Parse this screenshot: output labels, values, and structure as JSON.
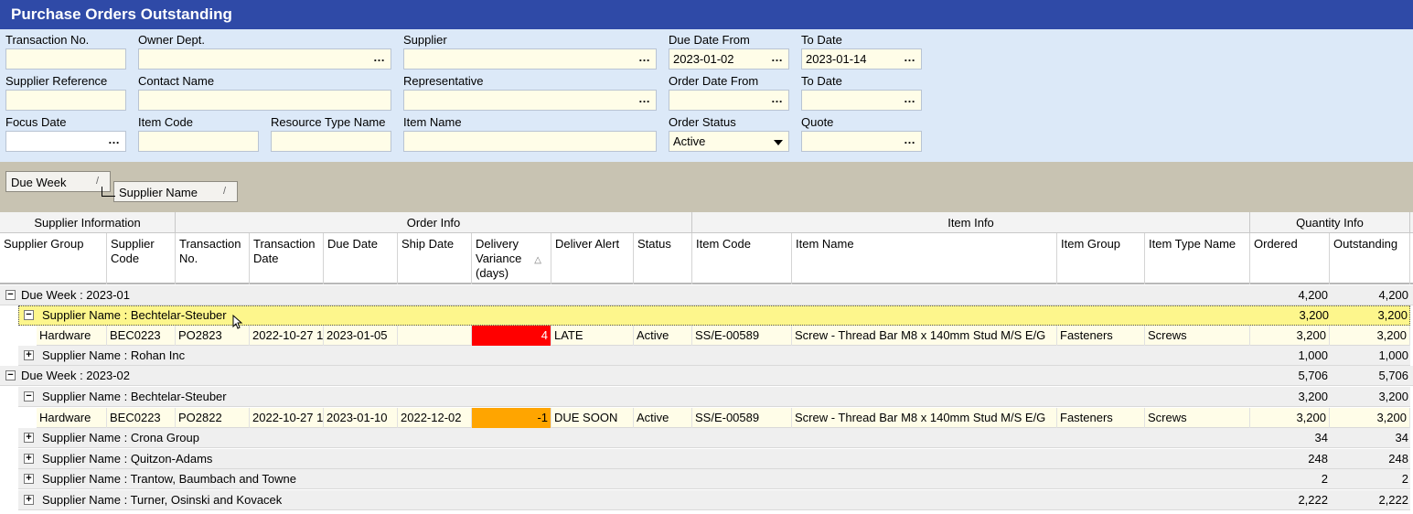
{
  "window": {
    "title": "Purchase Orders Outstanding"
  },
  "filters": {
    "transaction_no": {
      "label": "Transaction No.",
      "value": ""
    },
    "owner_dept": {
      "label": "Owner Dept.",
      "value": ""
    },
    "supplier": {
      "label": "Supplier",
      "value": ""
    },
    "due_date_from": {
      "label": "Due Date From",
      "value": "2023-01-02"
    },
    "due_to_date": {
      "label": "To Date",
      "value": "2023-01-14"
    },
    "supplier_reference": {
      "label": "Supplier Reference",
      "value": ""
    },
    "contact_name": {
      "label": "Contact Name",
      "value": ""
    },
    "representative": {
      "label": "Representative",
      "value": ""
    },
    "order_date_from": {
      "label": "Order Date From",
      "value": ""
    },
    "order_to_date": {
      "label": "To Date",
      "value": ""
    },
    "focus_date": {
      "label": "Focus Date",
      "value": ""
    },
    "item_code": {
      "label": "Item Code",
      "value": ""
    },
    "resource_type_name": {
      "label": "Resource Type Name",
      "value": ""
    },
    "item_name": {
      "label": "Item Name",
      "value": ""
    },
    "order_status": {
      "label": "Order Status",
      "value": "Active"
    },
    "quote": {
      "label": "Quote",
      "value": ""
    },
    "ellipsis": "…"
  },
  "grouping": {
    "level1": "Due Week",
    "level2": "Supplier Name",
    "sort_glyph": "/"
  },
  "bands": {
    "supplier_info": "Supplier Information",
    "order_info": "Order Info",
    "item_info": "Item Info",
    "quantity_info": "Quantity Info"
  },
  "columns": {
    "supplier_group": "Supplier Group",
    "supplier_code": "Supplier Code",
    "transaction_no": "Transaction No.",
    "transaction_date": "Transaction Date",
    "due_date": "Due Date",
    "ship_date": "Ship Date",
    "delivery_variance": "Delivery Variance (days)",
    "deliver_alert": "Deliver Alert",
    "status": "Status",
    "item_code": "Item Code",
    "item_name": "Item Name",
    "item_group": "Item Group",
    "item_type_name": "Item Type Name",
    "ordered": "Ordered",
    "outstanding": "Outstanding",
    "sort_arrow": "△"
  },
  "rows": {
    "week1": {
      "label": "Due Week : 2023-01",
      "ordered": "4,200",
      "outstanding": "4,200",
      "toggle": "−"
    },
    "week1_bech": {
      "label": "Supplier Name : Bechtelar-Steuber",
      "ordered": "3,200",
      "outstanding": "3,200",
      "toggle": "−"
    },
    "week1_bech_item": {
      "supplier_group": "Hardware",
      "supplier_code": "BEC0223",
      "transaction_no": "PO2823",
      "transaction_date": "2022-10-27 1",
      "due_date": "2023-01-05",
      "ship_date": "",
      "delivery_variance": "4",
      "deliver_alert": "LATE",
      "status": "Active",
      "item_code": "SS/E-00589",
      "item_name": "Screw - Thread Bar M8 x 140mm Stud M/S E/G",
      "item_group": "Fasteners",
      "item_type_name": "Screws",
      "ordered": "3,200",
      "outstanding": "3,200",
      "alert_color": "#ff0000"
    },
    "week1_rohan": {
      "label": "Supplier Name : Rohan Inc",
      "ordered": "1,000",
      "outstanding": "1,000",
      "toggle": "+"
    },
    "week2": {
      "label": "Due Week : 2023-02",
      "ordered": "5,706",
      "outstanding": "5,706",
      "toggle": "−"
    },
    "week2_bech": {
      "label": "Supplier Name : Bechtelar-Steuber",
      "ordered": "3,200",
      "outstanding": "3,200",
      "toggle": "−"
    },
    "week2_bech_item": {
      "supplier_group": "Hardware",
      "supplier_code": "BEC0223",
      "transaction_no": "PO2822",
      "transaction_date": "2022-10-27 1",
      "due_date": "2023-01-10",
      "ship_date": "2022-12-02",
      "delivery_variance": "-1",
      "deliver_alert": "DUE SOON",
      "status": "Active",
      "item_code": "SS/E-00589",
      "item_name": "Screw - Thread Bar M8 x 140mm Stud M/S E/G",
      "item_group": "Fasteners",
      "item_type_name": "Screws",
      "ordered": "3,200",
      "outstanding": "3,200",
      "alert_color": "#ffa500"
    },
    "week2_crona": {
      "label": "Supplier Name : Crona Group",
      "ordered": "34",
      "outstanding": "34",
      "toggle": "+"
    },
    "week2_quitzon": {
      "label": "Supplier Name : Quitzon-Adams",
      "ordered": "248",
      "outstanding": "248",
      "toggle": "+"
    },
    "week2_trantow": {
      "label": "Supplier Name : Trantow, Baumbach and Towne",
      "ordered": "2",
      "outstanding": "2",
      "toggle": "+"
    },
    "week2_turner": {
      "label": "Supplier Name : Turner, Osinski and Kovacek",
      "ordered": "2,222",
      "outstanding": "2,222",
      "toggle": "+"
    }
  },
  "colors": {
    "title_bg": "#2f4aa7",
    "filter_bg": "#dce9f8",
    "group_area_bg": "#c8c3b2",
    "highlight": "#fdf68c"
  }
}
